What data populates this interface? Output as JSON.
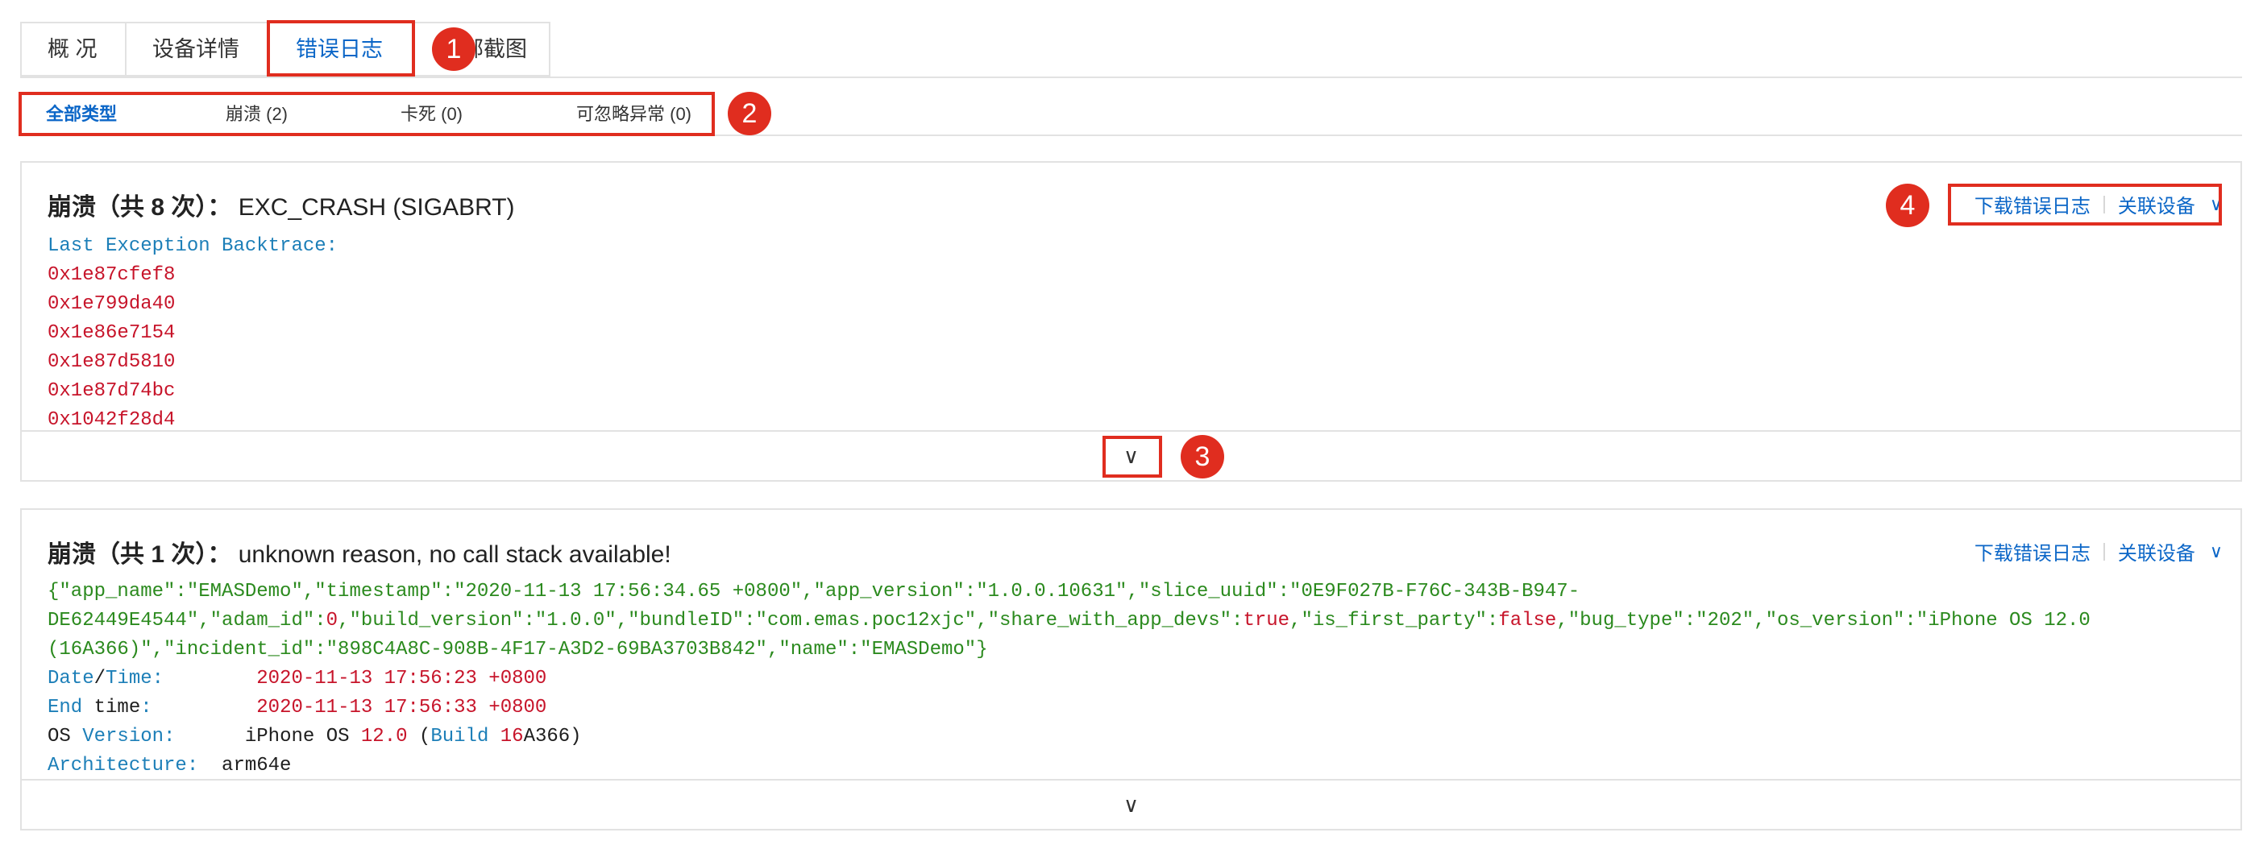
{
  "tabs": [
    {
      "label": "概 况"
    },
    {
      "label": "设备详情"
    },
    {
      "label": "错误日志"
    },
    {
      "label": "部截图"
    }
  ],
  "filters": [
    {
      "label": "全部类型"
    },
    {
      "label": "崩溃 (2)"
    },
    {
      "label": "卡死 (0)"
    },
    {
      "label": "可忽略异常 (0)"
    }
  ],
  "markers": [
    "1",
    "2",
    "3",
    "4"
  ],
  "card1": {
    "title_prefix": "崩溃（共 8 次）：",
    "title_reason": "EXC_CRASH (SIGABRT)",
    "download_label": "下载错误日志",
    "link_label": "关联设备",
    "chevron": "∨",
    "lines": {
      "backtrace_key": "Last Exception Backtrace",
      "backtrace_colon": ":",
      "addr1": "0x1e87cfef8",
      "addr2": "0x1e799da40",
      "addr3": "0x1e86e7154",
      "addr4": "0x1e87d5810",
      "addr5": "0x1e87d74bc",
      "addr6": "0x1042f28d4"
    },
    "expand_icon": "∨"
  },
  "card2": {
    "title_prefix": "崩溃（共 1 次）：",
    "title_reason": "unknown reason, no call stack available!",
    "download_label": "下载错误日志",
    "link_label": "关联设备",
    "chevron": "∨",
    "json_line1": {
      "a": "{\"app_name\":\"EMASDemo\",\"timestamp\":\"2020-11-13 17:56:34.65 +0800\",\"app_version\":\"1.0.0.10631\",\"slice_uuid\":\"0E9F027B-F76C-343B-B947-"
    },
    "json_line2": {
      "a": "DE62449E4544\",\"adam_id\":",
      "b": "0",
      "c": ",\"build_version\":\"1.0.0\",\"bundleID\":\"com.emas.poc12xjc\",\"share_with_app_devs\":",
      "d": "true",
      "e": ",\"is_first_party\":",
      "f": "false",
      "g": ",\"bug_type\":\"202\",\"os_version\":\"iPhone OS 12.0"
    },
    "json_line3": {
      "a": "(16A366)\",\"incident_id\":\"898C4A8C-908B-4F17-A3D2-69BA3703B842\",\"name\":\"EMASDemo\"}"
    },
    "date_time": {
      "k1": "Date",
      "slash": "/",
      "k2": "Time",
      "colon": ":",
      "pad": "        ",
      "value": "2020-11-13 17:56:23 +0800"
    },
    "end_time": {
      "k1": "End",
      "k2": " time",
      "colon": ":",
      "pad": "         ",
      "value": "2020-11-13 17:56:33 +0800"
    },
    "os_version": {
      "k1": "OS ",
      "k2": "Version",
      "colon": ":",
      "pad": "      ",
      "v1": "iPhone OS ",
      "v2": "12.0",
      "v3": " (",
      "v4": "Build ",
      "v5": "16",
      "v6": "A366)"
    },
    "architecture": {
      "k1": "Architecture",
      "colon": ":",
      "pad": "  ",
      "value": "arm64e"
    },
    "expand_icon": "∨"
  },
  "colors": {
    "accent_blue": "#0b66c7",
    "highlight_red": "#e02d1f",
    "code_red": "#c7142a",
    "code_green": "#2b8a1e",
    "code_blue": "#1d7fb8"
  }
}
